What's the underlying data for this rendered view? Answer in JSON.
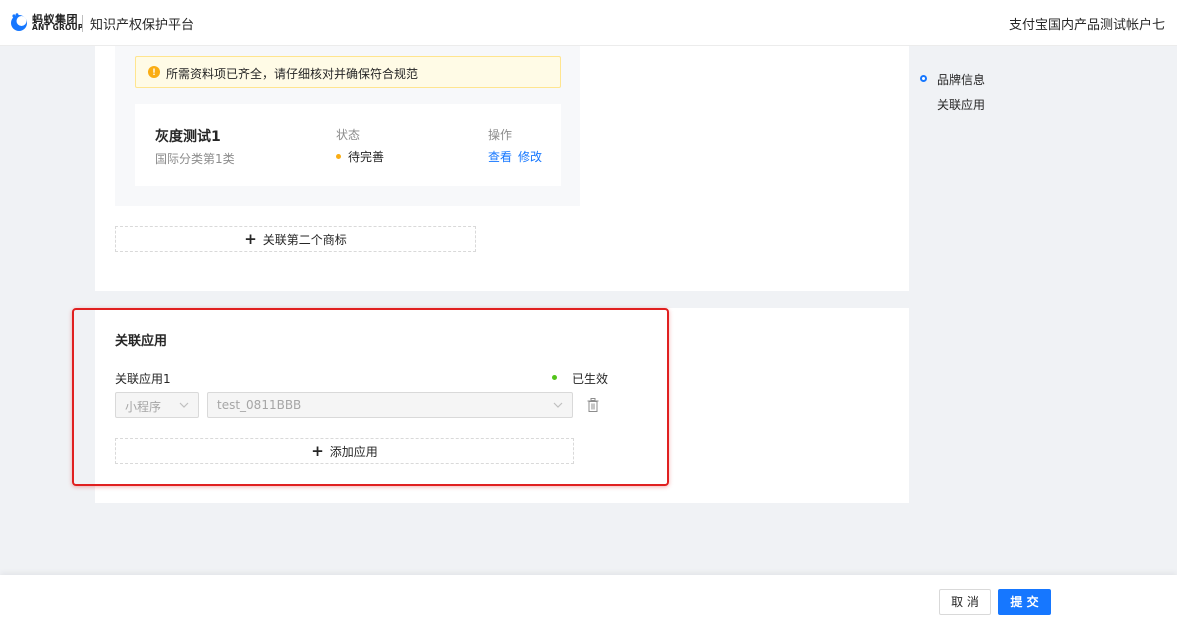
{
  "header": {
    "logo_cn": "蚂蚁集团",
    "logo_en": "ANT GROUP",
    "platform_title": "知识产权保护平台",
    "account_name": "支付宝国内产品测试帐户七"
  },
  "brand_section": {
    "alert_text": "所需资料项已齐全，请仔细核对并确保符合规范",
    "item": {
      "name": "灰度测试1",
      "classification": "国际分类第1类",
      "status_label": "状态",
      "status_value": "待完善",
      "operation_label": "操作",
      "view_label": "查看",
      "edit_label": "修改"
    },
    "add_button_label": "关联第二个商标"
  },
  "app_section": {
    "title": "关联应用",
    "app_label": "关联应用1",
    "status_text": "已生效",
    "type_select_value": "小程序",
    "app_select_value": "test_0811BBB",
    "add_button_label": "添加应用"
  },
  "anchor_nav": {
    "items": [
      "品牌信息",
      "关联应用"
    ]
  },
  "footer": {
    "cancel_label": "取 消",
    "submit_label": "提 交"
  },
  "colors": {
    "primary": "#1677ff",
    "warning": "#faad14",
    "success": "#52c41a",
    "highlight": "#e02020"
  }
}
